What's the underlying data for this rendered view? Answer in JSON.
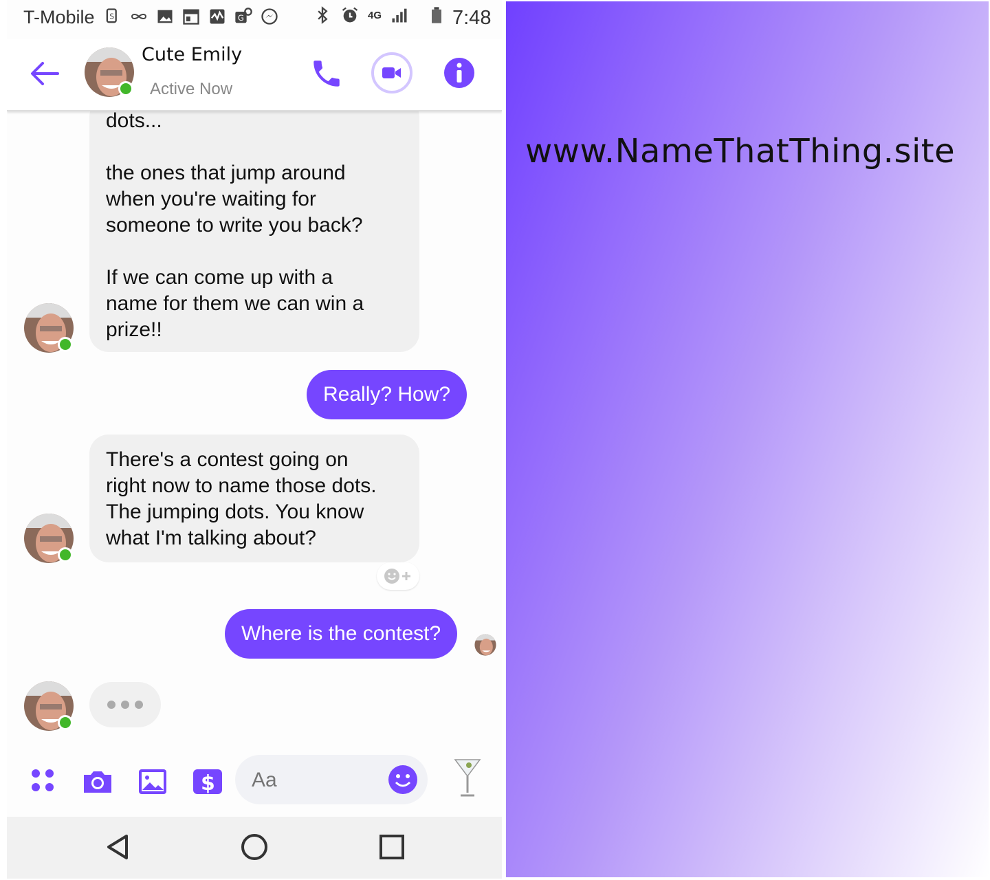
{
  "status_bar": {
    "carrier": "T-Mobile",
    "network": "4G",
    "time": "7:48",
    "icons": [
      "sync-icon",
      "infinity-icon",
      "gallery-icon",
      "calendar-icon",
      "activity-icon",
      "translate-icon",
      "messenger-icon",
      "bluetooth-icon",
      "alarm-icon",
      "signal-icon",
      "battery-icon"
    ]
  },
  "header": {
    "contact_name": "Cute Emily",
    "status": "Active Now",
    "accent_color": "#7646ff"
  },
  "messages": [
    {
      "from": "contact",
      "lines": [
        "dots...",
        "",
        "the ones that jump around",
        "when you're waiting for",
        "someone to write you back?",
        "",
        "If we can come up with a",
        "name for them we can win a",
        "prize!!"
      ]
    },
    {
      "from": "me",
      "text": "Really? How?"
    },
    {
      "from": "contact",
      "lines": [
        "There's a contest going on",
        "right now to name those dots.",
        "The jumping dots. You know",
        "what I'm talking about?"
      ]
    },
    {
      "from": "me",
      "text": "Where is the contest?"
    }
  ],
  "composer": {
    "placeholder": "Aa",
    "icons": [
      "more-apps-icon",
      "camera-icon",
      "gallery-icon",
      "payment-icon",
      "emoji-icon",
      "cocktail-icon"
    ]
  },
  "navbar": {
    "icons": [
      "back-triangle-icon",
      "home-circle-icon",
      "recents-square-icon"
    ]
  },
  "promo": {
    "text": "www.NameThatThing.site",
    "gradient_start": "#7040ff",
    "gradient_end": "#ffffff"
  }
}
